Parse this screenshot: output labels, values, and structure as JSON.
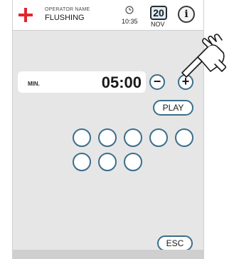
{
  "header": {
    "operator_label": "OPERATOR NAME",
    "operator_value": "FLUSHING",
    "time": "10:35",
    "date_day": "20",
    "date_month": "NOV",
    "info_label": "i"
  },
  "timer": {
    "unit_label": "MIN.",
    "value": "05:00",
    "minus_label": "−",
    "plus_label": "+"
  },
  "buttons": {
    "play_label": "PLAY",
    "esc_label": "ESC"
  },
  "selection_circles": {
    "count": 8
  },
  "colors": {
    "accent": "#3b6e8c",
    "brand_red": "#e3262d",
    "date_fill": "#dceefa",
    "panel_bg": "#e6e6e6"
  },
  "icons": {
    "brand": "plus-icon",
    "clock": "clock-icon",
    "info": "info-icon",
    "pointer": "pointing-hand-icon"
  }
}
